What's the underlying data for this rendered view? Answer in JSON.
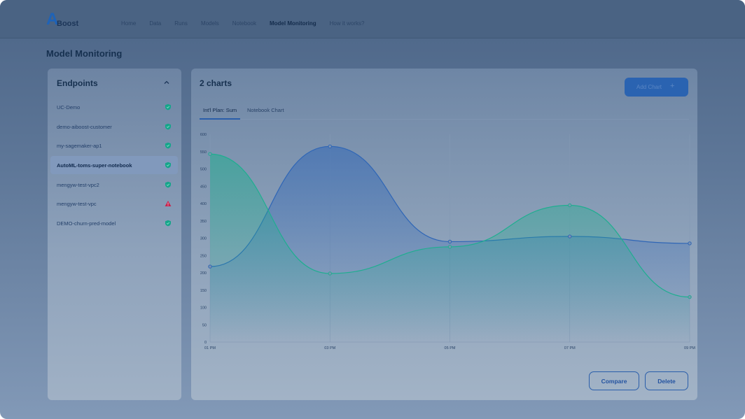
{
  "app": {
    "logo_letter": "A",
    "logo_word": "Boost",
    "nav": [
      "Home",
      "Data",
      "Runs",
      "Models",
      "Notebook",
      "Model Monitoring",
      "How it works?"
    ],
    "nav_active_index": 5
  },
  "page": {
    "title": "Model Monitoring"
  },
  "endpoints": {
    "title": "Endpoints",
    "items": [
      {
        "label": "UC-Demo",
        "status": "ok",
        "selected": false
      },
      {
        "label": "demo-aiboost-customer",
        "status": "ok",
        "selected": false
      },
      {
        "label": "my-sagemaker-ap1",
        "status": "ok",
        "selected": false
      },
      {
        "label": "AutoML-toms-super-notebook",
        "status": "ok",
        "selected": true
      },
      {
        "label": "mengyw-test-vpc2",
        "status": "ok",
        "selected": false
      },
      {
        "label": "mengyw-test-vpc",
        "status": "warning",
        "selected": false
      },
      {
        "label": "DEMO-churn-pred-model",
        "status": "ok",
        "selected": false
      }
    ],
    "icons": {
      "ok": "shield-check-icon",
      "warning": "warning-triangle-icon",
      "collapse": "chevron-up-icon"
    }
  },
  "main": {
    "title": "2 charts",
    "add_chart_label": "Add Chart",
    "add_chart_icon": "plus-icon",
    "tabs": [
      "Int'l Plan: Sum",
      "Notebook Chart"
    ],
    "active_tab": 0,
    "compare_label": "Compare",
    "delete_label": "Delete"
  },
  "colors": {
    "accent": "#2a63b1",
    "series_blue": "#2f66b6",
    "series_teal": "#1fae90",
    "ok": "#15a58a",
    "warning": "#c8234d"
  },
  "chart_data": {
    "type": "area",
    "categories": [
      "01 PM",
      "03 PM",
      "05 PM",
      "07 PM",
      "09 PM"
    ],
    "series": [
      {
        "values": [
          218,
          565,
          290,
          305,
          285
        ]
      },
      {
        "values": [
          543,
          198,
          275,
          395,
          130
        ]
      }
    ],
    "yticks": [
      0,
      50,
      100,
      150,
      200,
      250,
      300,
      350,
      400,
      450,
      500,
      550,
      600
    ],
    "ylim": [
      0,
      600
    ],
    "grid": "vertical",
    "title": "",
    "xlabel": "",
    "ylabel": ""
  }
}
